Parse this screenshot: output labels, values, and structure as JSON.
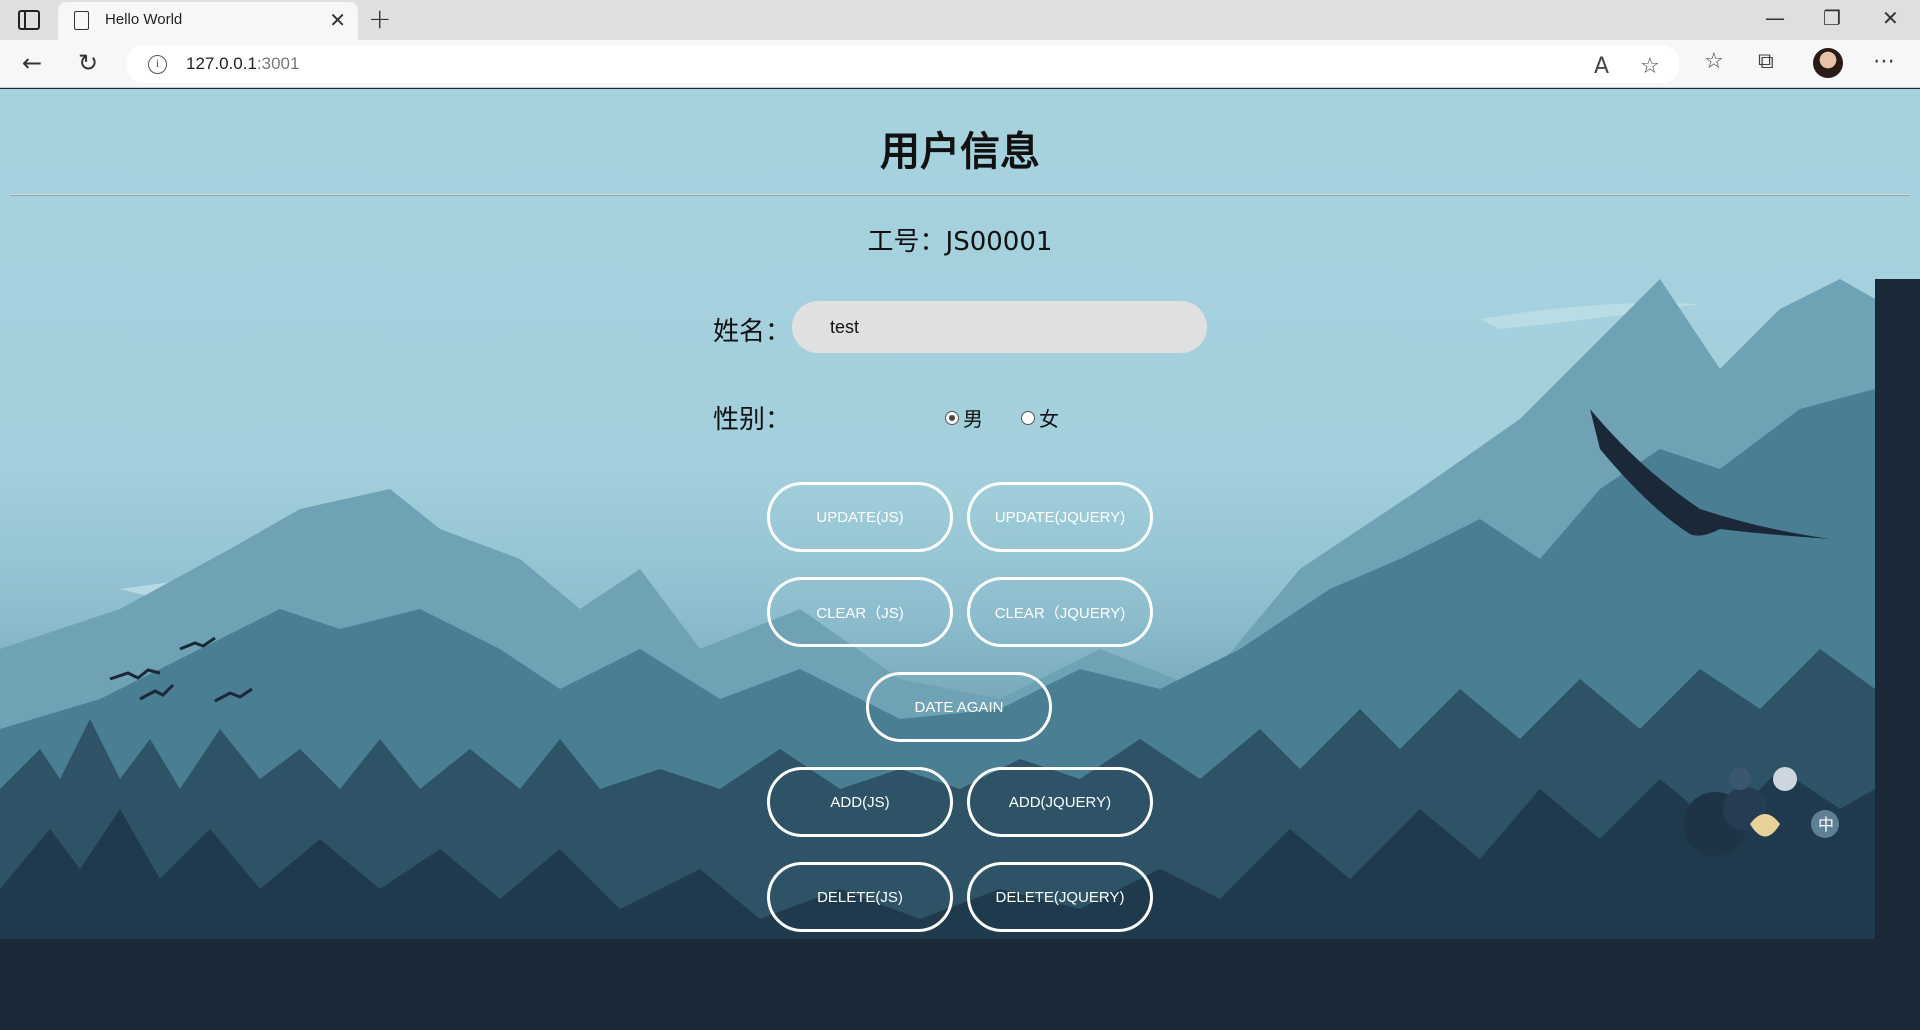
{
  "browser": {
    "tab_title": "Hello World",
    "tab_close": "✕",
    "new_tab": "+",
    "url_host": "127.0.0.1",
    "url_port": ":3001",
    "minimize": "—",
    "restore": "❐",
    "close": "✕"
  },
  "page": {
    "title": "用户信息",
    "employee_no": "工号：JS00001",
    "name_label": "姓名：",
    "name_value": "test",
    "gender_label": "性别：",
    "gender_options": [
      {
        "label": "男",
        "checked": true
      },
      {
        "label": "女",
        "checked": false
      }
    ],
    "buttons": {
      "update_js": "UPDATE(JS)",
      "update_jquery": "UPDATE(JQUERY)",
      "clear_js": "CLEAR（JS)",
      "clear_jquery": "CLEAR（JQUERY)",
      "date_again": "DATE AGAIN",
      "add_js": "ADD(JS)",
      "add_jquery": "ADD(JQUERY)",
      "delete_js": "DELETE(JS)",
      "delete_jquery": "DELETE(JQUERY)"
    }
  },
  "colors": {
    "sky": "#a6d2de",
    "mountain_far": "#6fa2b4",
    "mountain_mid": "#4a7e93",
    "forest_dark": "#1b2838",
    "button_border": "#ffffff"
  }
}
